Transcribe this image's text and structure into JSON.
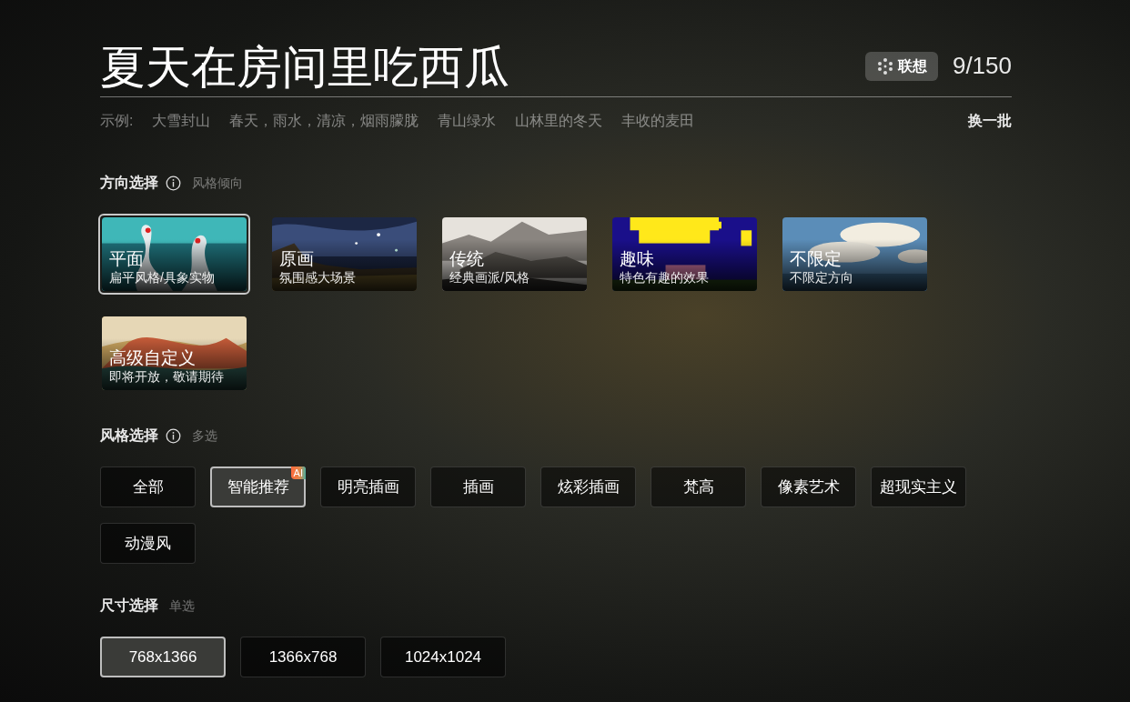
{
  "title": "夏天在房间里吃西瓜",
  "assoc_button": "联想",
  "counter": "9/150",
  "examples": {
    "label": "示例:",
    "items": [
      "大雪封山",
      "春天，雨水，清凉，烟雨朦胧",
      "青山绿水",
      "山林里的冬天",
      "丰收的麦田"
    ]
  },
  "refresh": "换一批",
  "direction": {
    "heading": "方向选择",
    "hint": "风格倾向",
    "options": [
      {
        "title": "平面",
        "subtitle": "扁平风格/具象实物",
        "selected": true
      },
      {
        "title": "原画",
        "subtitle": "氛围感大场景",
        "selected": false
      },
      {
        "title": "传统",
        "subtitle": "经典画派/风格",
        "selected": false
      },
      {
        "title": "趣味",
        "subtitle": "特色有趣的效果",
        "selected": false
      },
      {
        "title": "不限定",
        "subtitle": "不限定方向",
        "selected": false
      },
      {
        "title": "高级自定义",
        "subtitle": "即将开放，敬请期待",
        "selected": false
      }
    ]
  },
  "style": {
    "heading": "风格选择",
    "hint": "多选",
    "options": [
      {
        "label": "全部",
        "selected": false
      },
      {
        "label": "智能推荐",
        "selected": true,
        "badge": "AI"
      },
      {
        "label": "明亮插画",
        "selected": false
      },
      {
        "label": "插画",
        "selected": false
      },
      {
        "label": "炫彩插画",
        "selected": false
      },
      {
        "label": "梵高",
        "selected": false
      },
      {
        "label": "像素艺术",
        "selected": false
      },
      {
        "label": "超现实主义",
        "selected": false
      },
      {
        "label": "动漫风",
        "selected": false
      }
    ]
  },
  "size": {
    "heading": "尺寸选择",
    "hint": "单选",
    "options": [
      {
        "label": "768x1366",
        "selected": true
      },
      {
        "label": "1366x768",
        "selected": false
      },
      {
        "label": "1024x1024",
        "selected": false
      }
    ]
  }
}
